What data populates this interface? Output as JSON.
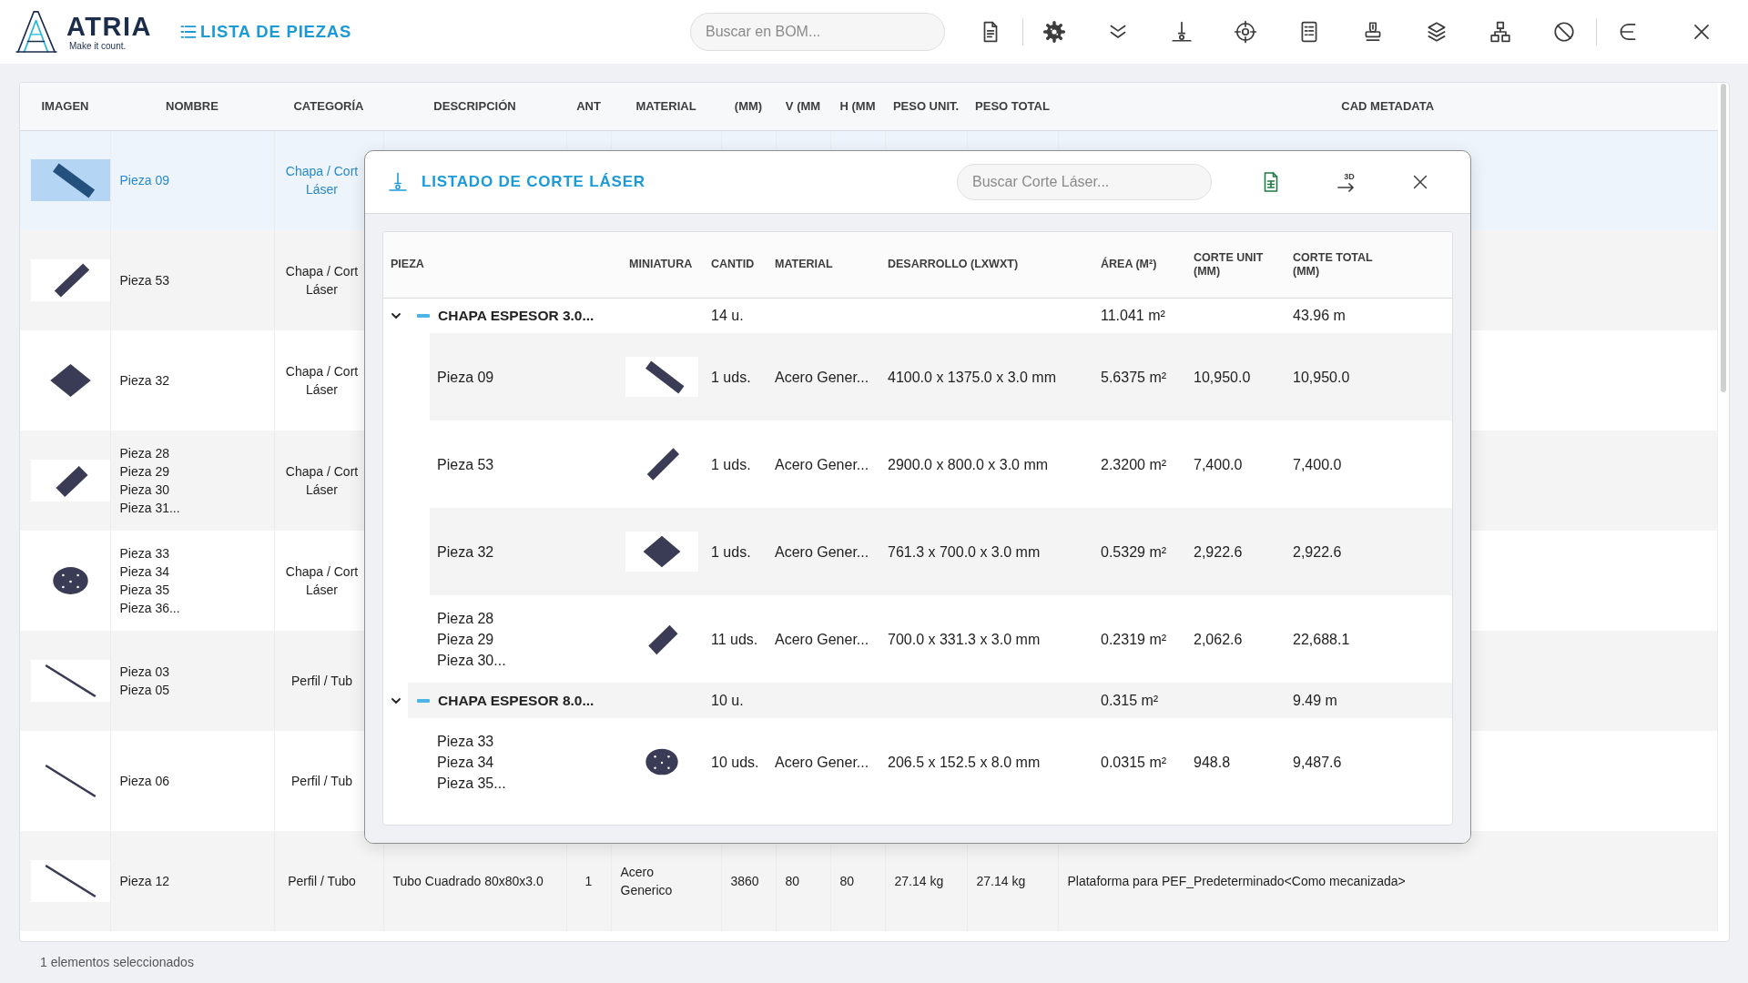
{
  "header": {
    "brand": "ATRIA",
    "tagline": "Make it count.",
    "title": "LISTA DE PIEZAS",
    "search_placeholder": "Buscar en BOM..."
  },
  "bom_table": {
    "columns": [
      "IMAGEN",
      "NOMBRE",
      "CATEGORÍA",
      "DESCRIPCIÓN",
      "ANT",
      "MATERIAL",
      "(MM)",
      "V (MM",
      "H (MM",
      "PESO UNIT.",
      "PESO TOTAL",
      "CAD METADATA"
    ],
    "rows": [
      {
        "kind": "band",
        "selected": true,
        "names": [
          "Pieza 09"
        ],
        "category": "Chapa / Cort Láser"
      },
      {
        "kind": "plank",
        "selected": false,
        "names": [
          "Pieza 53"
        ],
        "category": "Chapa / Cort Láser"
      },
      {
        "kind": "square",
        "selected": false,
        "names": [
          "Pieza 32"
        ],
        "category": "Chapa / Cort Láser"
      },
      {
        "kind": "slab",
        "selected": false,
        "names": [
          "Pieza 28",
          "Pieza 29",
          "Pieza 30",
          "Pieza 31..."
        ],
        "category": "Chapa / Cort Láser"
      },
      {
        "kind": "disc",
        "selected": false,
        "names": [
          "Pieza 33",
          "Pieza 34",
          "Pieza 35",
          "Pieza 36..."
        ],
        "category": "Chapa / Cort Láser"
      },
      {
        "kind": "rod",
        "selected": false,
        "names": [
          "Pieza 03",
          "Pieza 05"
        ],
        "category": "Perfil / Tub"
      },
      {
        "kind": "rod",
        "selected": false,
        "names": [
          "Pieza 06"
        ],
        "category": "Perfil / Tub"
      },
      {
        "kind": "rod",
        "selected": false,
        "names": [
          "Pieza 12"
        ],
        "category": "Perfil / Tubo",
        "description": "Tubo Cuadrado 80x80x3.0",
        "quantity": "1",
        "material": "Acero Generico",
        "l_mm": "3860",
        "w_mm": "80",
        "h_mm": "80",
        "unit_weight": "27.14 kg",
        "total_weight": "27.14 kg",
        "cad_metadata": "Plataforma para PEF_Predeterminado<Como mecanizada>"
      }
    ]
  },
  "status_bar": {
    "text": "1 elementos seleccionados"
  },
  "laser_dialog": {
    "title": "LISTADO DE CORTE LÁSER",
    "search_placeholder": "Buscar Corte Láser...",
    "export_3d_label": "3D",
    "columns": [
      "PIEZA",
      "MINIATURA",
      "CANTID",
      "MATERIAL",
      "DESARROLLO (LXWXT)",
      "ÁREA (M²)",
      "CORTE UNIT (MM)",
      "CORTE TOTAL (MM)"
    ],
    "groups": [
      {
        "label": "CHAPA ESPESOR 3.0...",
        "expanded": true,
        "quantity": "14 u.",
        "area": "11.041 m²",
        "cut_total": "43.96 m",
        "items": [
          {
            "kind": "band",
            "names": [
              "Pieza 09"
            ],
            "quantity": "1 uds.",
            "material": "Acero Gener...",
            "development": "4100.0 x 1375.0 x 3.0 mm",
            "area": "5.6375 m²",
            "cut_unit": "10,950.0",
            "cut_total": "10,950.0"
          },
          {
            "kind": "plank",
            "names": [
              "Pieza 53"
            ],
            "quantity": "1 uds.",
            "material": "Acero Gener...",
            "development": "2900.0 x 800.0 x 3.0 mm",
            "area": "2.3200 m²",
            "cut_unit": "7,400.0",
            "cut_total": "7,400.0"
          },
          {
            "kind": "square",
            "names": [
              "Pieza 32"
            ],
            "quantity": "1 uds.",
            "material": "Acero Gener...",
            "development": "761.3 x 700.0 x 3.0 mm",
            "area": "0.5329 m²",
            "cut_unit": "2,922.6",
            "cut_total": "2,922.6"
          },
          {
            "kind": "slab",
            "names": [
              "Pieza 28",
              "Pieza 29",
              "Pieza 30..."
            ],
            "quantity": "11 uds.",
            "material": "Acero Gener...",
            "development": "700.0 x 331.3 x 3.0 mm",
            "area": "0.2319 m²",
            "cut_unit": "2,062.6",
            "cut_total": "22,688.1"
          }
        ]
      },
      {
        "label": "CHAPA ESPESOR 8.0...",
        "expanded": true,
        "quantity": "10 u.",
        "area": "0.315 m²",
        "cut_total": "9.49 m",
        "items": [
          {
            "kind": "disc",
            "names": [
              "Pieza 33",
              "Pieza 34",
              "Pieza 35..."
            ],
            "quantity": "10 uds.",
            "material": "Acero Gener...",
            "development": "206.5 x 152.5 x 8.0 mm",
            "area": "0.0315 m²",
            "cut_unit": "948.8",
            "cut_total": "9,487.6"
          }
        ]
      }
    ]
  }
}
